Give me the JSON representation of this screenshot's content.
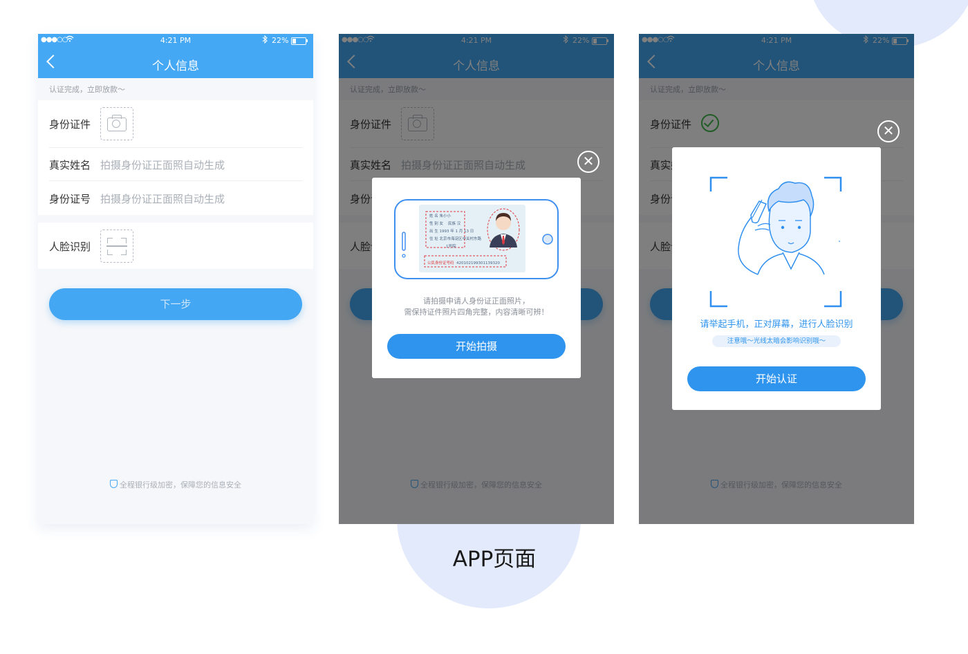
{
  "colors": {
    "primary": "#45a8f5",
    "button": "#2f94ee",
    "success": "#42b84c",
    "background": "#f6f7fa",
    "decor": "#e3eafc"
  },
  "caption": "APP页面",
  "status_bar": {
    "signal": "●●●○○",
    "wifi_icon": "wifi-icon",
    "time": "4:21 PM",
    "bluetooth_icon": "bluetooth-icon",
    "battery": "22%"
  },
  "nav": {
    "title": "个人信息",
    "back_icon": "chevron-left-icon"
  },
  "form": {
    "notice": "认证完成，立即放款～",
    "id_label": "身份证件",
    "name_label": "真实姓名",
    "name_hint": "拍摄身份证正面照自动生成",
    "idno_label": "身份证号",
    "idno_hint": "拍摄身份证正面照自动生成",
    "face_label": "人脸识别",
    "next_button": "下一步",
    "footer": "全程银行级加密，保障您的信息安全"
  },
  "id_modal": {
    "card": {
      "name_key": "姓 名",
      "name": "朱小小",
      "sex_key": "性 别",
      "sex": "女",
      "nation_key": "民族",
      "nation": "汉",
      "birth_key": "出 生",
      "birth": "1993 年 1 月 13 日",
      "addr_key": "住 址",
      "addr1": "北京市海淀区中关村东路",
      "addr2": "1号院",
      "id_key": "公民身份证号码",
      "id_number": "420102199301139320"
    },
    "text1": "请拍摄申请人身份证正面照片，",
    "text2": "需保持证件照片四角完整，内容清晰可辨！",
    "button": "开始拍摄",
    "close_icon": "close-icon"
  },
  "face_modal": {
    "title": "请举起手机，正对屏幕，进行人脸识别",
    "note": "注意哦～光线太暗会影响识别哦～",
    "button": "开始认证",
    "close_icon": "close-icon"
  }
}
